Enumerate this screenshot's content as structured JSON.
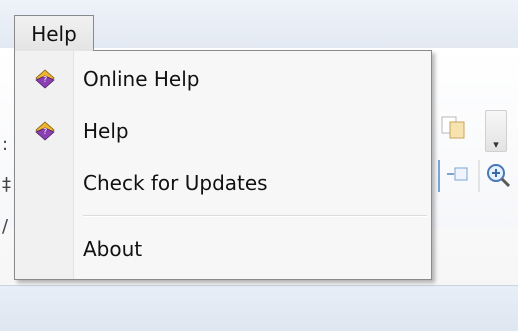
{
  "menubar": {
    "help_label": "Help"
  },
  "help_menu": {
    "items": [
      {
        "label": "Online Help",
        "icon": "help-book-icon"
      },
      {
        "label": "Help",
        "icon": "help-book-icon"
      },
      {
        "label": "Check for Updates",
        "icon": ""
      },
      {
        "label": "About",
        "icon": ""
      }
    ]
  },
  "colors": {
    "book_purple": "#8a3fb3",
    "book_gold": "#f0b430"
  }
}
